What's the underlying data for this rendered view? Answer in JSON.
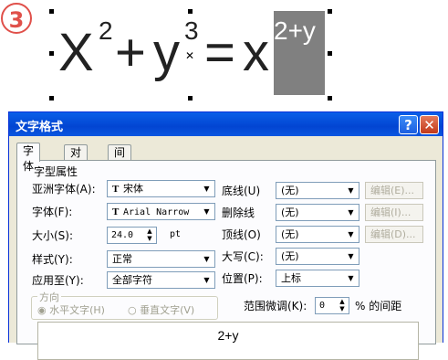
{
  "step_marker": "3",
  "formula": {
    "x_base": "X",
    "x_exp": "2",
    "plus": "+",
    "y_base": "y",
    "y_exp": "3",
    "equals": "=",
    "rhs_base": "x",
    "rhs_exp": "2+y",
    "highlight_color": "#808080"
  },
  "dialog": {
    "title": "文字格式",
    "help_glyph": "?",
    "close_glyph": "✕",
    "tabs": [
      "字体",
      "对齐",
      "间距"
    ],
    "active_tab": "字体",
    "section_label": "字型属性",
    "fields": {
      "asian_font_label": "亚洲字体(A):",
      "asian_font_value": "宋体",
      "font_label": "字体(F):",
      "font_value": "Arial Narrow",
      "size_label": "大小(S):",
      "size_value": "24.0",
      "size_unit": "pt",
      "style_label": "样式(Y):",
      "style_value": "正常",
      "apply_label": "应用至(Y):",
      "apply_value": "全部字符",
      "underline_label": "底线(U)",
      "underline_value": "(无)",
      "strike_label": "删除线",
      "strike_value": "(无)",
      "overline_label": "顶线(O)",
      "overline_value": "(无)",
      "caps_label": "大写(C):",
      "caps_value": "(无)",
      "position_label": "位置(P):",
      "position_value": "上标",
      "edit_btn_1": "编辑(E)...",
      "edit_btn_2": "编辑(I)...",
      "edit_btn_3": "编辑(D)...",
      "direction_label": "方向",
      "horizontal_label": "水平文字(H)",
      "vertical_label": "垂直文字(V)",
      "range_label": "范围微调(K):",
      "range_value": "0",
      "range_suffix": "% 的间距",
      "tt_glyph": "T"
    },
    "preview_text": "2+y"
  }
}
